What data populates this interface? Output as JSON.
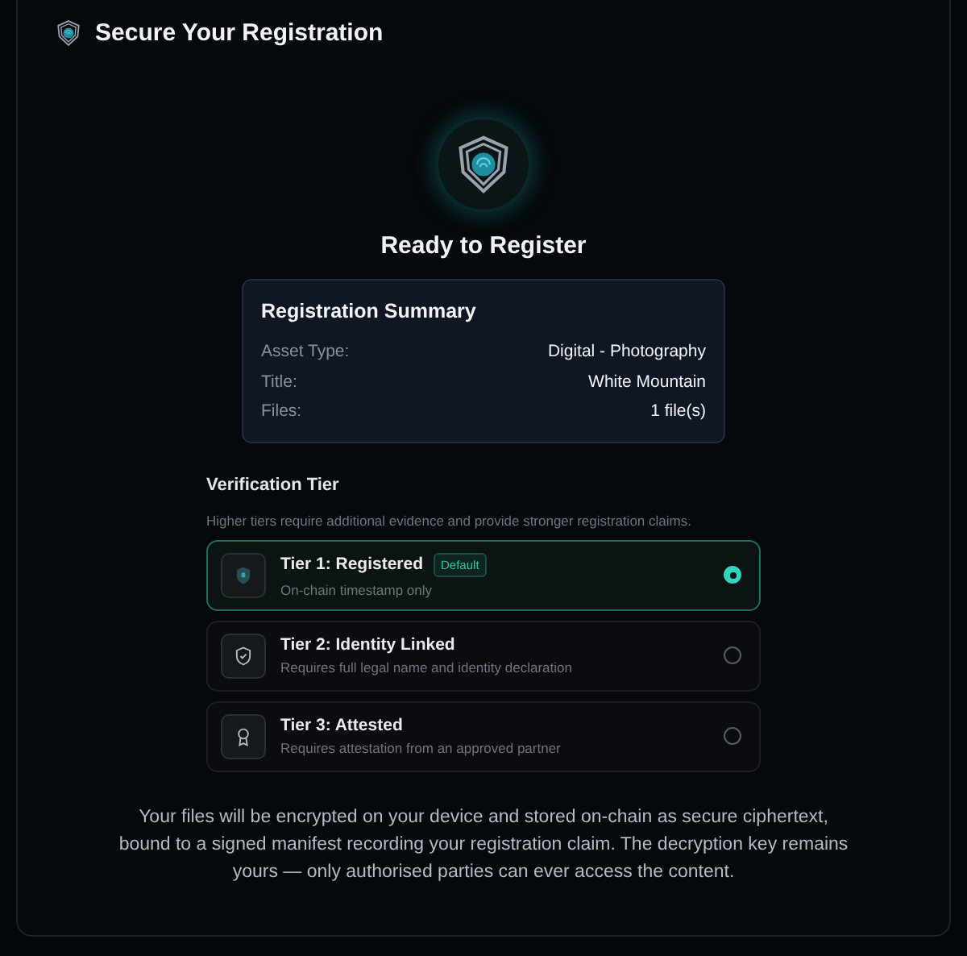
{
  "header": {
    "title": "Secure Your Registration"
  },
  "heading": "Ready to Register",
  "summary": {
    "title": "Registration Summary",
    "rows": [
      {
        "label": "Asset Type:",
        "value": "Digital - Photography"
      },
      {
        "label": "Title:",
        "value": "White Mountain"
      },
      {
        "label": "Files:",
        "value": "1 file(s)"
      }
    ]
  },
  "tiers": {
    "title": "Verification Tier",
    "description": "Higher tiers require additional evidence and provide stronger registration claims.",
    "options": [
      {
        "kind": "shield",
        "name": "Tier 1: Registered",
        "badge": "Default",
        "detail": "On-chain timestamp only",
        "selected": true
      },
      {
        "kind": "check",
        "name": "Tier 2: Identity Linked",
        "detail": "Requires full legal name and identity declaration",
        "selected": false
      },
      {
        "kind": "award",
        "name": "Tier 3: Attested",
        "detail": "Requires attestation from an approved partner",
        "selected": false
      }
    ]
  },
  "note": "Your files will be encrypted on your device and stored on-chain as secure ciphertext, bound to a signed manifest recording your registration claim. The decryption key remains yours — only authorised parties can ever access the content."
}
